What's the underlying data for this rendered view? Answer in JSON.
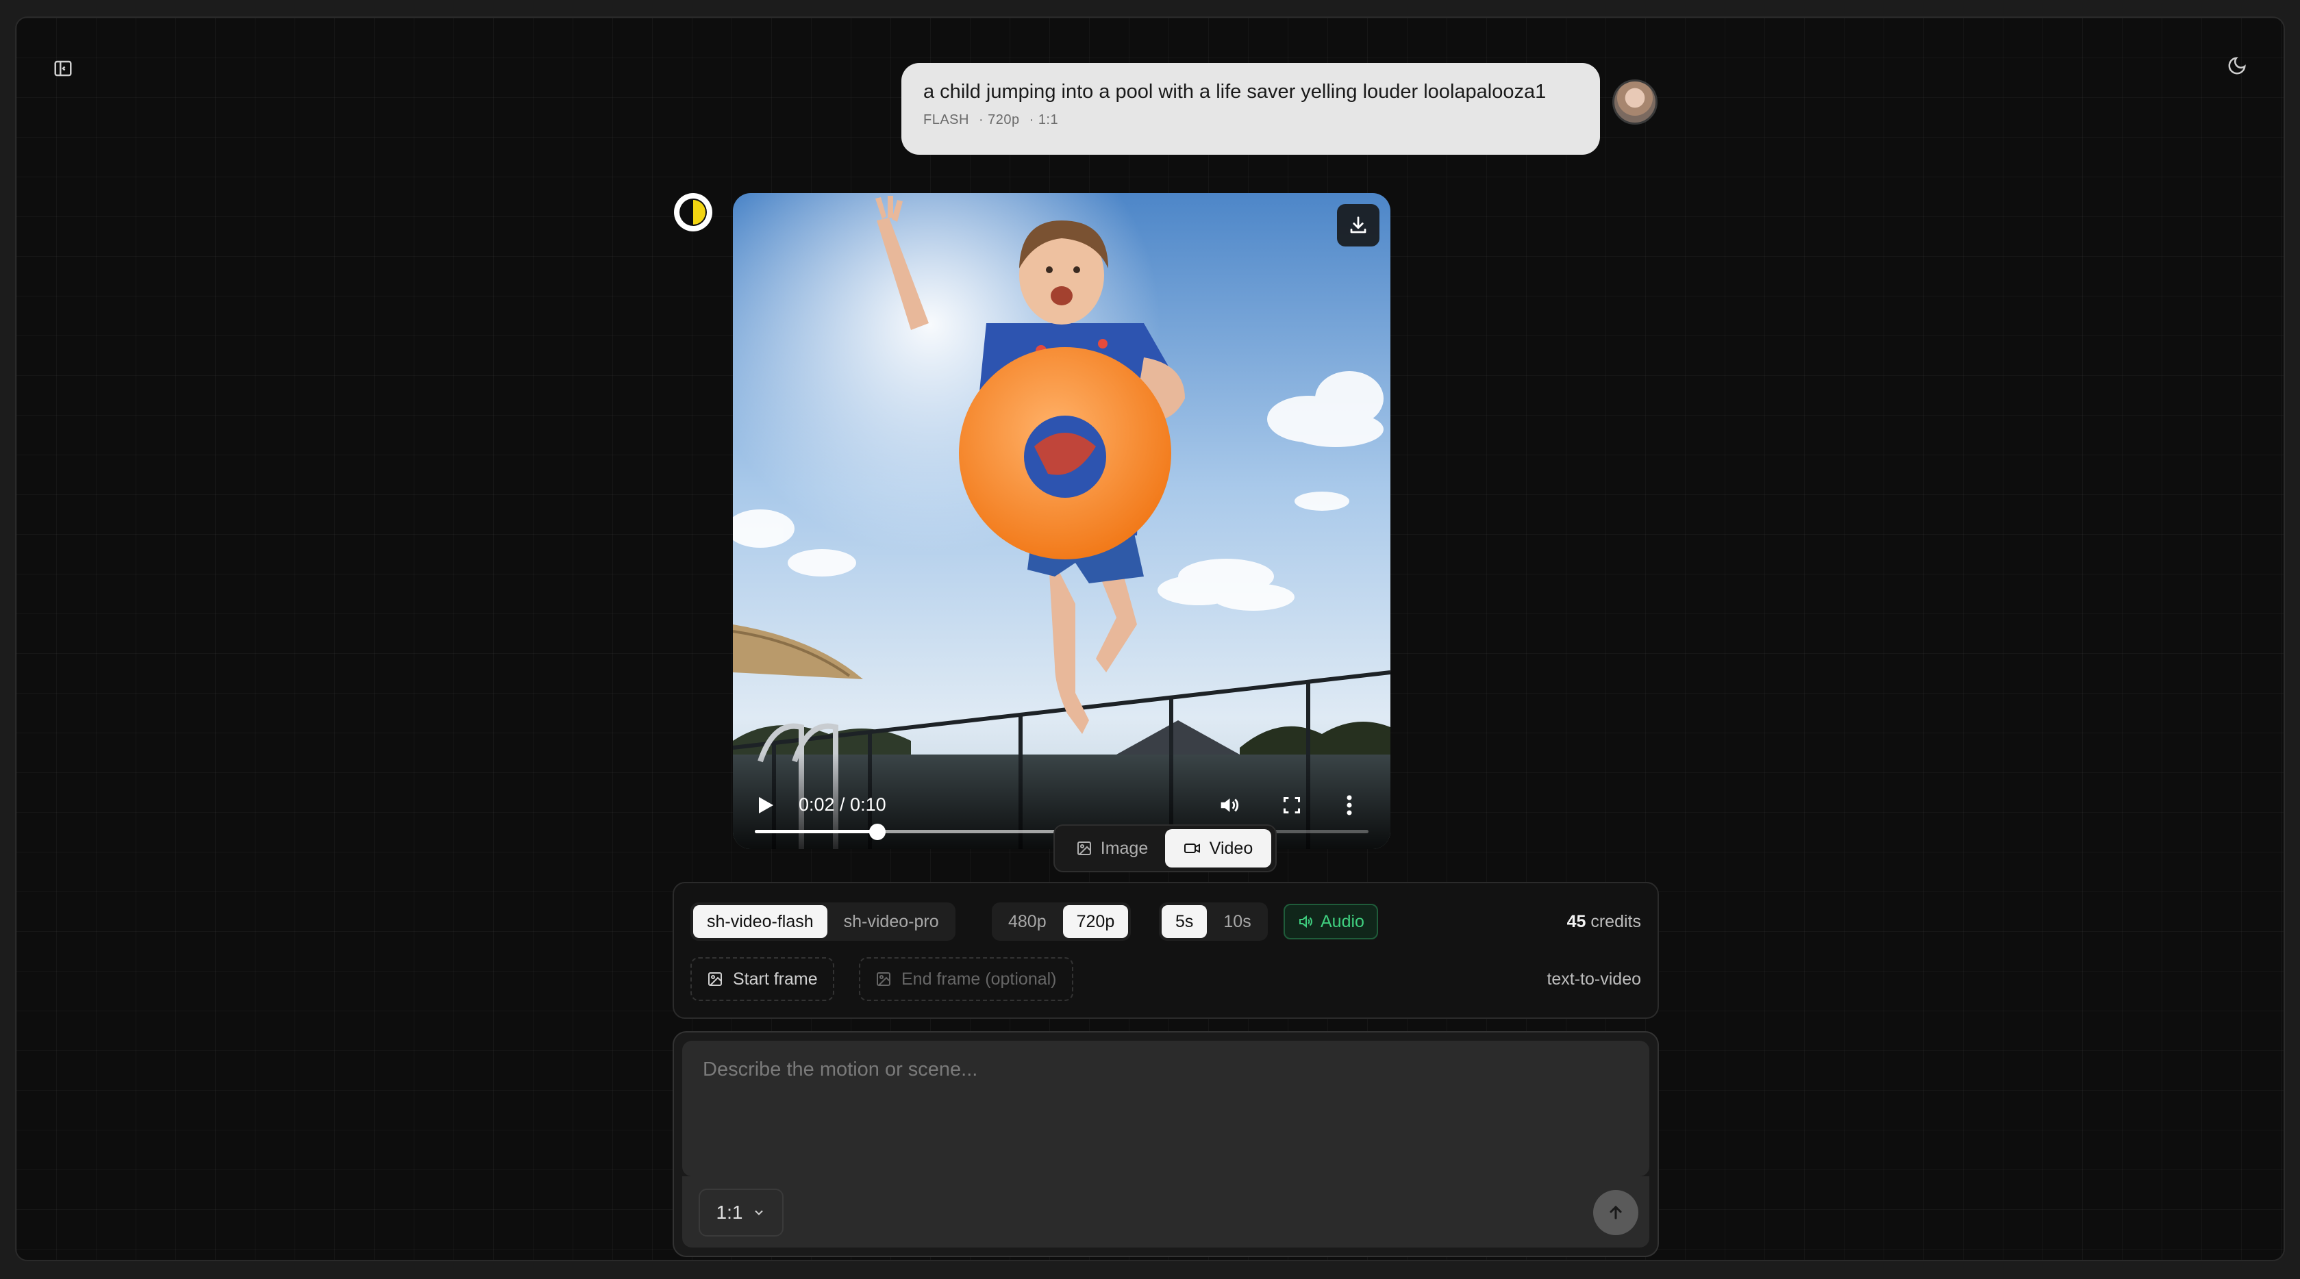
{
  "user_message": {
    "prompt": "a child jumping into a pool with a life saver yelling louder loolapalooza1",
    "meta": {
      "model": "FLASH",
      "resolution": "720p",
      "aspect": "1:1"
    }
  },
  "video": {
    "time_display": "0:02 / 0:10",
    "progress_fraction": 0.2,
    "buffered_fraction": 0.59
  },
  "media_toggle": {
    "options": [
      {
        "label": "Image",
        "icon": "image-icon"
      },
      {
        "label": "Video",
        "icon": "video-icon"
      }
    ],
    "selected": "Video"
  },
  "settings": {
    "models": [
      "sh-video-flash",
      "sh-video-pro"
    ],
    "selected_model": "sh-video-flash",
    "resolutions": [
      "480p",
      "720p"
    ],
    "selected_resolution": "720p",
    "durations": [
      "5s",
      "10s"
    ],
    "selected_duration": "5s",
    "audio_label": "Audio",
    "credits_value": "45",
    "credits_label": "credits",
    "start_frame_label": "Start frame",
    "end_frame_label": "End frame (optional)",
    "mode_label": "text-to-video"
  },
  "composer": {
    "placeholder": "Describe the motion or scene...",
    "aspect_ratio": "1:1"
  },
  "colors": {
    "background": "#0d0d0d",
    "accent_yellow": "#f2d411",
    "audio_green": "#3fcf7f",
    "bubble": "#e6e6e6"
  }
}
